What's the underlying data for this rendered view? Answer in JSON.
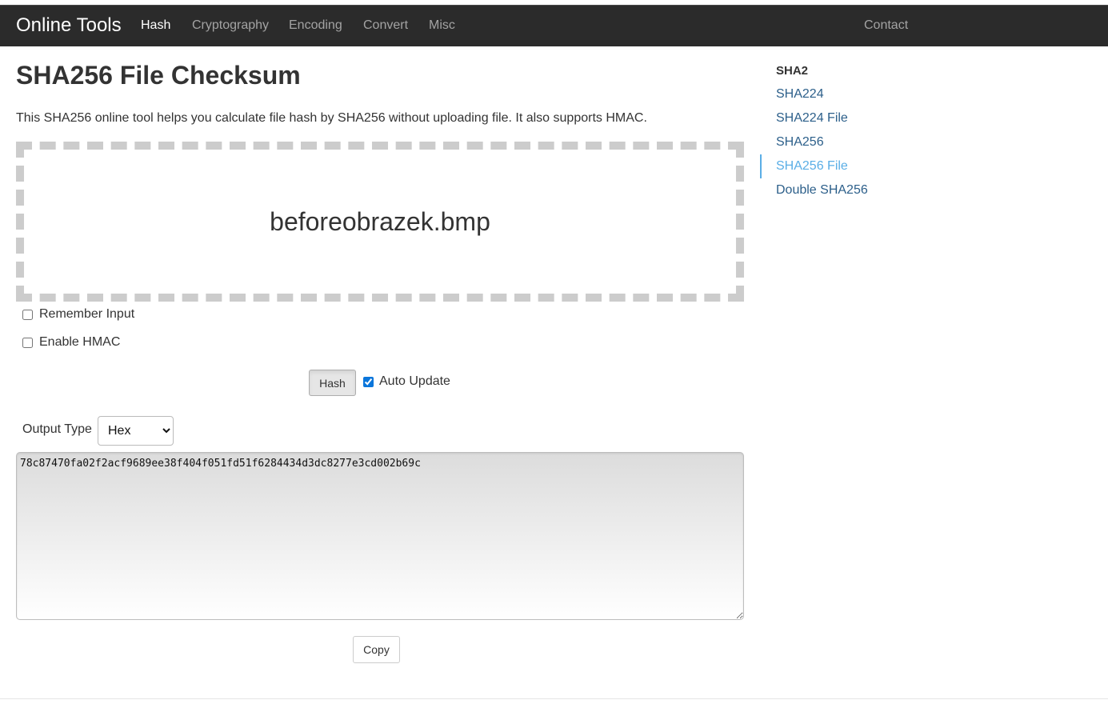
{
  "navbar": {
    "brand": "Online Tools",
    "items": [
      {
        "label": "Hash",
        "active": true
      },
      {
        "label": "Cryptography",
        "active": false
      },
      {
        "label": "Encoding",
        "active": false
      },
      {
        "label": "Convert",
        "active": false
      },
      {
        "label": "Misc",
        "active": false
      }
    ],
    "contact": "Contact"
  },
  "main": {
    "title": "SHA256 File Checksum",
    "description": "This SHA256 online tool helps you calculate file hash by SHA256 without uploading file. It also supports HMAC.",
    "dropzone_filename": "beforeobrazek.bmp",
    "remember_input_label": "Remember Input",
    "remember_input_checked": false,
    "enable_hmac_label": "Enable HMAC",
    "enable_hmac_checked": false,
    "hash_button": "Hash",
    "auto_update_label": "Auto Update",
    "auto_update_checked": true,
    "output_type_label": "Output Type",
    "output_type_value": "Hex",
    "output_value": "78c87470fa02f2acf9689ee38f404f051fd51f6284434d3dc8277e3cd002b69c",
    "copy_button": "Copy"
  },
  "sidebar": {
    "heading": "SHA2",
    "items": [
      {
        "label": "SHA224",
        "active": false
      },
      {
        "label": "SHA224 File",
        "active": false
      },
      {
        "label": "SHA256",
        "active": false
      },
      {
        "label": "SHA256 File",
        "active": true
      },
      {
        "label": "Double SHA256",
        "active": false
      }
    ]
  },
  "colors": {
    "navbar_bg": "#2b2b2b",
    "sidebar_active": "#5aaee6",
    "sidebar_link": "#2c5f8a"
  }
}
